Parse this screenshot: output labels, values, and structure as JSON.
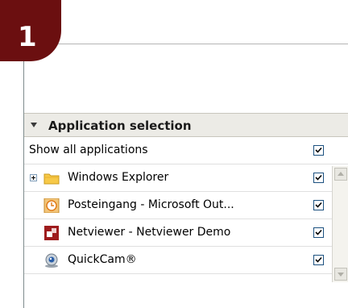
{
  "step": {
    "number": "1"
  },
  "panel": {
    "title": "Application selection",
    "show_all_label": "Show all applications",
    "show_all_checked": true,
    "applications": [
      {
        "label": "Windows Explorer",
        "icon": "folder-icon",
        "checked": true,
        "expandable": true
      },
      {
        "label": "Posteingang - Microsoft Out...",
        "icon": "outlook-clock-icon",
        "checked": true
      },
      {
        "label": "Netviewer - Netviewer Demo",
        "icon": "netviewer-icon",
        "checked": true
      },
      {
        "label": "QuickCam®",
        "icon": "webcam-icon",
        "checked": true
      }
    ]
  },
  "colors": {
    "badge": "#6b0f10",
    "header_bg": "#ecebe6",
    "checkbox_border": "#1c5180"
  }
}
